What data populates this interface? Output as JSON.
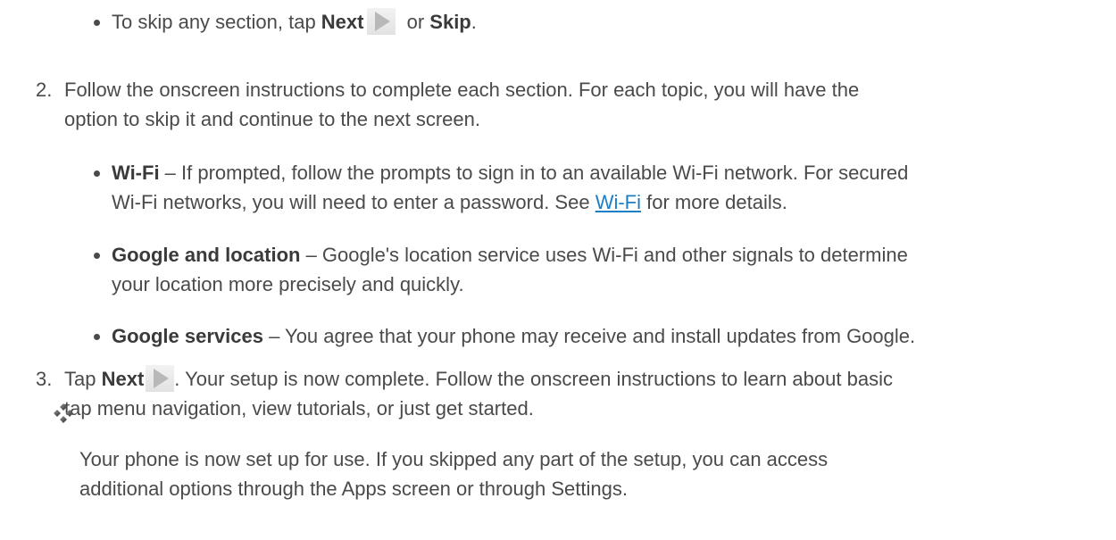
{
  "step1_bullet": {
    "pre": "To skip any section, tap ",
    "next": "Next",
    "mid": " or ",
    "skip": "Skip",
    "end": "."
  },
  "step2": {
    "number": "2.",
    "line1": "Follow the onscreen instructions to complete each section. For each topic, you will have the",
    "line2": "option to skip it and continue to the next screen."
  },
  "wifi": {
    "term": "Wi-Fi",
    "line1": " – If prompted, follow the prompts to sign in to an available Wi-Fi network. For secured",
    "line2_pre": "Wi-Fi networks, you will need to enter a password. See ",
    "link": "Wi-Fi",
    "line2_post": " for more details."
  },
  "location": {
    "term": "Google and location",
    "line1": " – Google's location service uses Wi-Fi and other signals to determine",
    "line2": "your location more precisely and quickly."
  },
  "services": {
    "term": "Google services",
    "line1": " – You agree that your phone may receive and install updates from Google."
  },
  "step3": {
    "number": "3.",
    "pre": "Tap ",
    "next": "Next",
    "line1_post": ". Your setup is now complete. Follow the onscreen instructions to learn about basic",
    "line2": "tap menu navigation, view tutorials, or just get started."
  },
  "note": {
    "icon": "four-diamond-icon",
    "line1": "Your phone is now set up for use. If you skipped any part of the setup, you can access",
    "line2": "additional options through the Apps screen or through Settings."
  }
}
